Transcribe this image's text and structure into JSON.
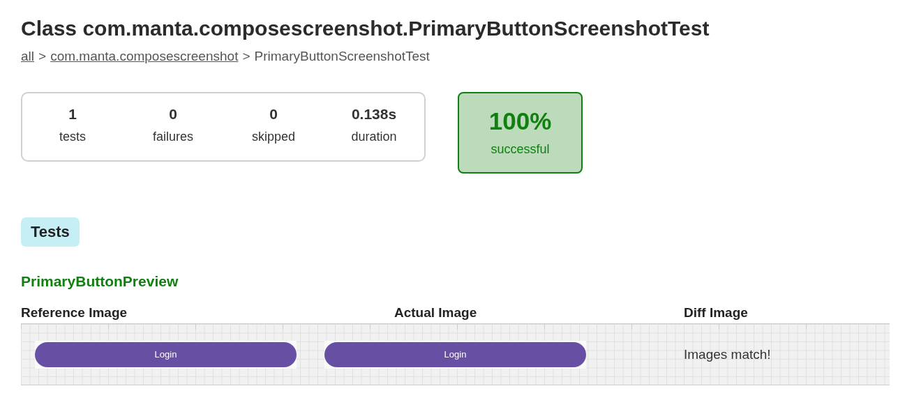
{
  "title": "Class com.manta.composescreenshot.PrimaryButtonScreenshotTest",
  "breadcrumb": [
    {
      "text": "all",
      "kind": "link"
    },
    {
      "text": ">",
      "kind": "separator"
    },
    {
      "text": "com.manta.composescreenshot",
      "kind": "link"
    },
    {
      "text": ">",
      "kind": "separator"
    },
    {
      "text": "PrimaryButtonScreenshotTest",
      "kind": "current"
    }
  ],
  "summary": [
    {
      "value": "1",
      "label": "tests"
    },
    {
      "value": "0",
      "label": "failures"
    },
    {
      "value": "0",
      "label": "skipped"
    },
    {
      "value": "0.138s",
      "label": "duration"
    }
  ],
  "success": {
    "value": "100%",
    "label": "successful"
  },
  "tests_tab": "Tests",
  "test": {
    "name": "PrimaryButtonPreview",
    "columns": [
      "Reference Image",
      "Actual Image",
      "Diff Image"
    ],
    "reference_button": "Login",
    "actual_button": "Login",
    "diff_result": "Images match!"
  }
}
